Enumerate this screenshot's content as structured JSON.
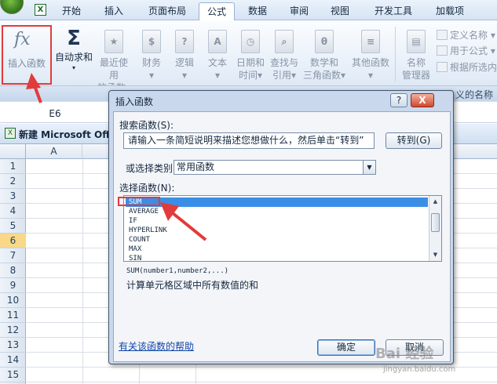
{
  "tabs": [
    {
      "label": "开始",
      "active": false
    },
    {
      "label": "插入",
      "active": false
    },
    {
      "label": "页面布局",
      "active": false
    },
    {
      "label": "公式",
      "active": true
    },
    {
      "label": "数据",
      "active": false
    },
    {
      "label": "审阅",
      "active": false
    },
    {
      "label": "视图",
      "active": false
    },
    {
      "label": "开发工具",
      "active": false
    },
    {
      "label": "加载项",
      "active": false
    }
  ],
  "ribbon": {
    "insert_function": "插入函数",
    "fx_symbol": "fx",
    "autosum": "自动求和",
    "sigma": "Σ",
    "buttons": [
      {
        "line1": "最近使用",
        "line2": "的函数▾",
        "glyph": "★"
      },
      {
        "line1": "财务",
        "line2": "▾",
        "glyph": "$"
      },
      {
        "line1": "逻辑",
        "line2": "▾",
        "glyph": "?"
      },
      {
        "line1": "文本",
        "line2": "▾",
        "glyph": "A"
      },
      {
        "line1": "日期和",
        "line2": "时间▾",
        "glyph": "◷"
      },
      {
        "line1": "查找与",
        "line2": "引用▾",
        "glyph": "⌕"
      },
      {
        "line1": "数学和",
        "line2": "三角函数▾",
        "glyph": "θ"
      },
      {
        "line1": "其他函数",
        "line2": "▾",
        "glyph": "≡"
      }
    ],
    "name_manager_l1": "名称",
    "name_manager_l2": "管理器",
    "define_name": "定义名称 ▾",
    "use_in_formula": "用于公式 ▾",
    "create_from_selection": "根据所选内",
    "group_name_fragment": "义的名称"
  },
  "namebox": "E6",
  "workbook": {
    "title": "新建 Microsoft Offi",
    "icon": "X"
  },
  "sheet": {
    "column": "A",
    "rows": [
      "1",
      "2",
      "3",
      "4",
      "5",
      "6",
      "7",
      "8",
      "9",
      "10",
      "11",
      "12",
      "13",
      "14",
      "15"
    ],
    "selected_row": "6"
  },
  "dialog": {
    "title": "插入函数",
    "help": "?",
    "close": "X",
    "search_label": "搜索函数(S):",
    "search_value": "请输入一条简短说明来描述您想做什么，然后单击“转到”",
    "go": "转到(G)",
    "category_label": "或选择类别(C):",
    "category_value": "常用函数",
    "select_label": "选择函数(N):",
    "functions": [
      "SUM",
      "AVERAGE",
      "IF",
      "HYPERLINK",
      "COUNT",
      "MAX",
      "SIN"
    ],
    "selected_function": "SUM",
    "signature": "SUM(number1,number2,...)",
    "description": "计算单元格区域中所有数值的和",
    "help_link": "有关该函数的帮助",
    "ok": "确定",
    "cancel": "取消"
  },
  "watermark": {
    "text": "Bai 经验",
    "url": "jingyan.baidu.com"
  },
  "colors": {
    "highlight": "#e23b3b",
    "selection": "#3b8ee6",
    "link": "#1246a8"
  }
}
